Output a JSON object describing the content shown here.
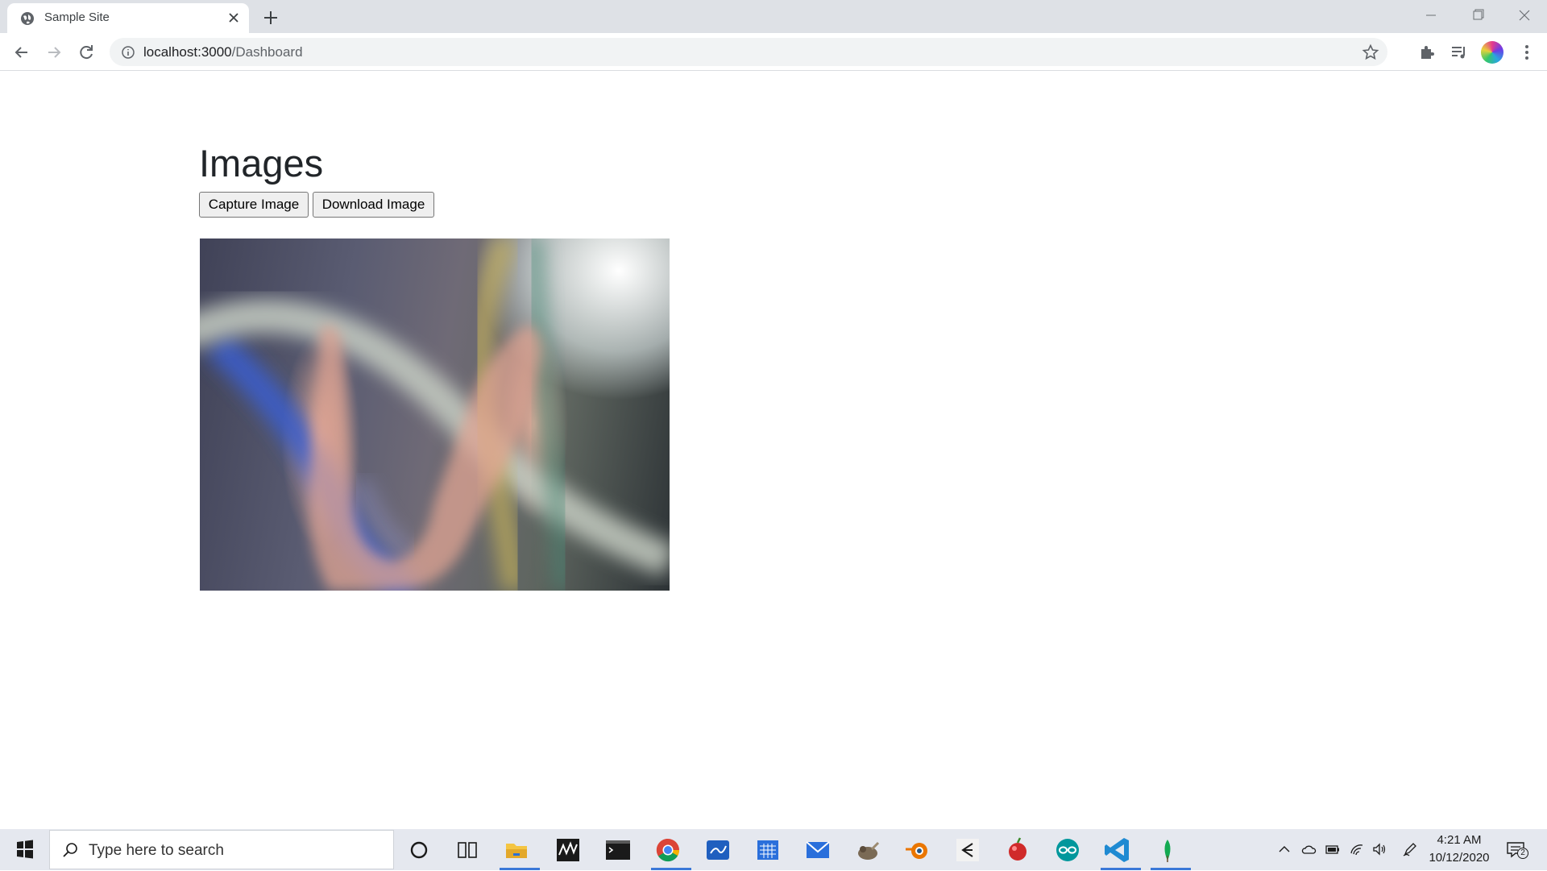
{
  "browser": {
    "tab_title": "Sample Site",
    "url_host": "localhost:3000",
    "url_path": "/Dashboard"
  },
  "page": {
    "heading": "Images",
    "capture_button": "Capture Image",
    "download_button": "Download Image"
  },
  "taskbar": {
    "search_placeholder": "Type here to search",
    "time": "4:21 AM",
    "date": "10/12/2020",
    "notification_count": "2"
  },
  "colors": {
    "tabbar_bg": "#dee1e6",
    "omnibox_bg": "#f1f3f4",
    "taskbar_bg": "#e5e8ef",
    "active_app_underline": "#3b78d8"
  }
}
